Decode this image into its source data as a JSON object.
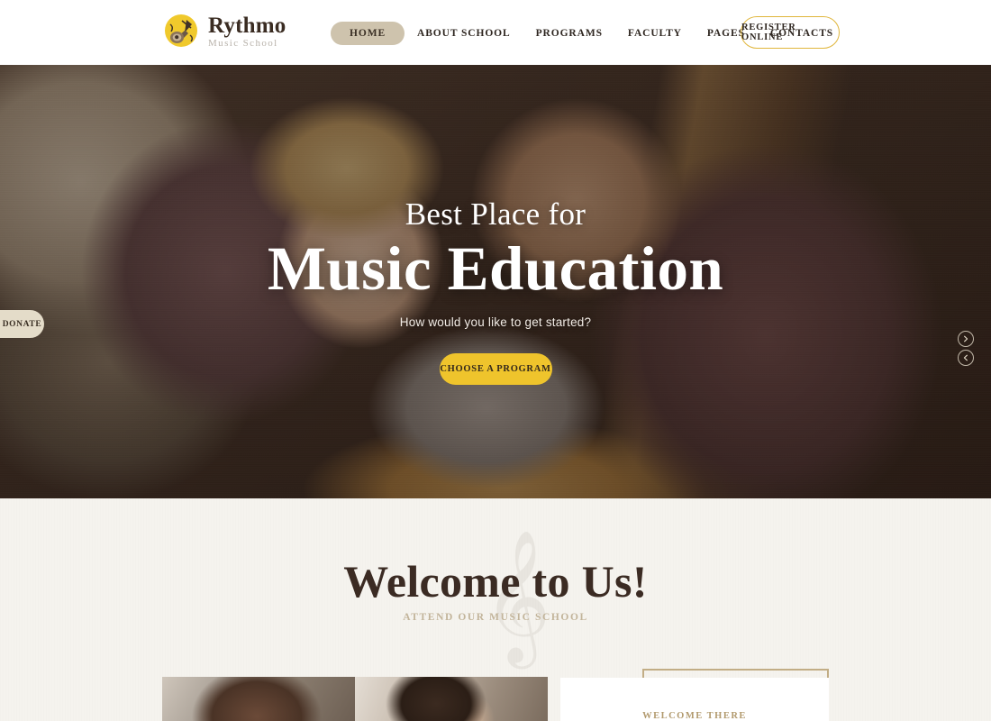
{
  "brand": {
    "name": "Rythmo",
    "tagline": "Music School",
    "logo_icon": "guitar-circle-icon",
    "logo_bg_color": "#f0c92c",
    "logo_guitar_color": "#4a3a2c"
  },
  "header": {
    "background_color": "#ffffff",
    "nav": [
      {
        "label": "HOME",
        "active": true
      },
      {
        "label": "ABOUT SCHOOL",
        "active": false
      },
      {
        "label": "PROGRAMS",
        "active": false
      },
      {
        "label": "FACULTY",
        "active": false
      },
      {
        "label": "PAGES",
        "active": false
      },
      {
        "label": "CONTACTS",
        "active": false
      }
    ],
    "active_pill_color": "#cec3ad",
    "register_button": {
      "label": "REGISTER ONLINE",
      "border_color": "#e0b63c"
    }
  },
  "hero": {
    "pretitle": "Best Place for",
    "title": "Music Education",
    "subtitle": "How would you like to get started?",
    "cta_label": "CHOOSE A PROGRAM",
    "cta_color": "#efc42c",
    "donate_tab_label": "DONATE",
    "donate_tab_color": "#e4dcc9",
    "slider": {
      "next_icon": "chevron-right-circle-icon",
      "prev_icon": "chevron-left-circle-icon"
    },
    "image_description": "Man and blond child playing an acoustic guitar together on a sofa"
  },
  "welcome": {
    "title": "Welcome to Us!",
    "subtitle": "ATTEND OUR MUSIC SCHOOL",
    "watermark_icon": "treble-clef-icon",
    "background_color": "#f5f3ee",
    "title_color": "#3b2b23",
    "subtitle_color": "#c2b49a"
  },
  "content": {
    "gallery": [
      {
        "alt": "Smiling woman with long brown hair"
      },
      {
        "alt": "Smiling bearded man looking down"
      }
    ],
    "card": {
      "label": "WELCOME THERE",
      "frame_color": "#c2ad85",
      "background_color": "#ffffff"
    }
  }
}
